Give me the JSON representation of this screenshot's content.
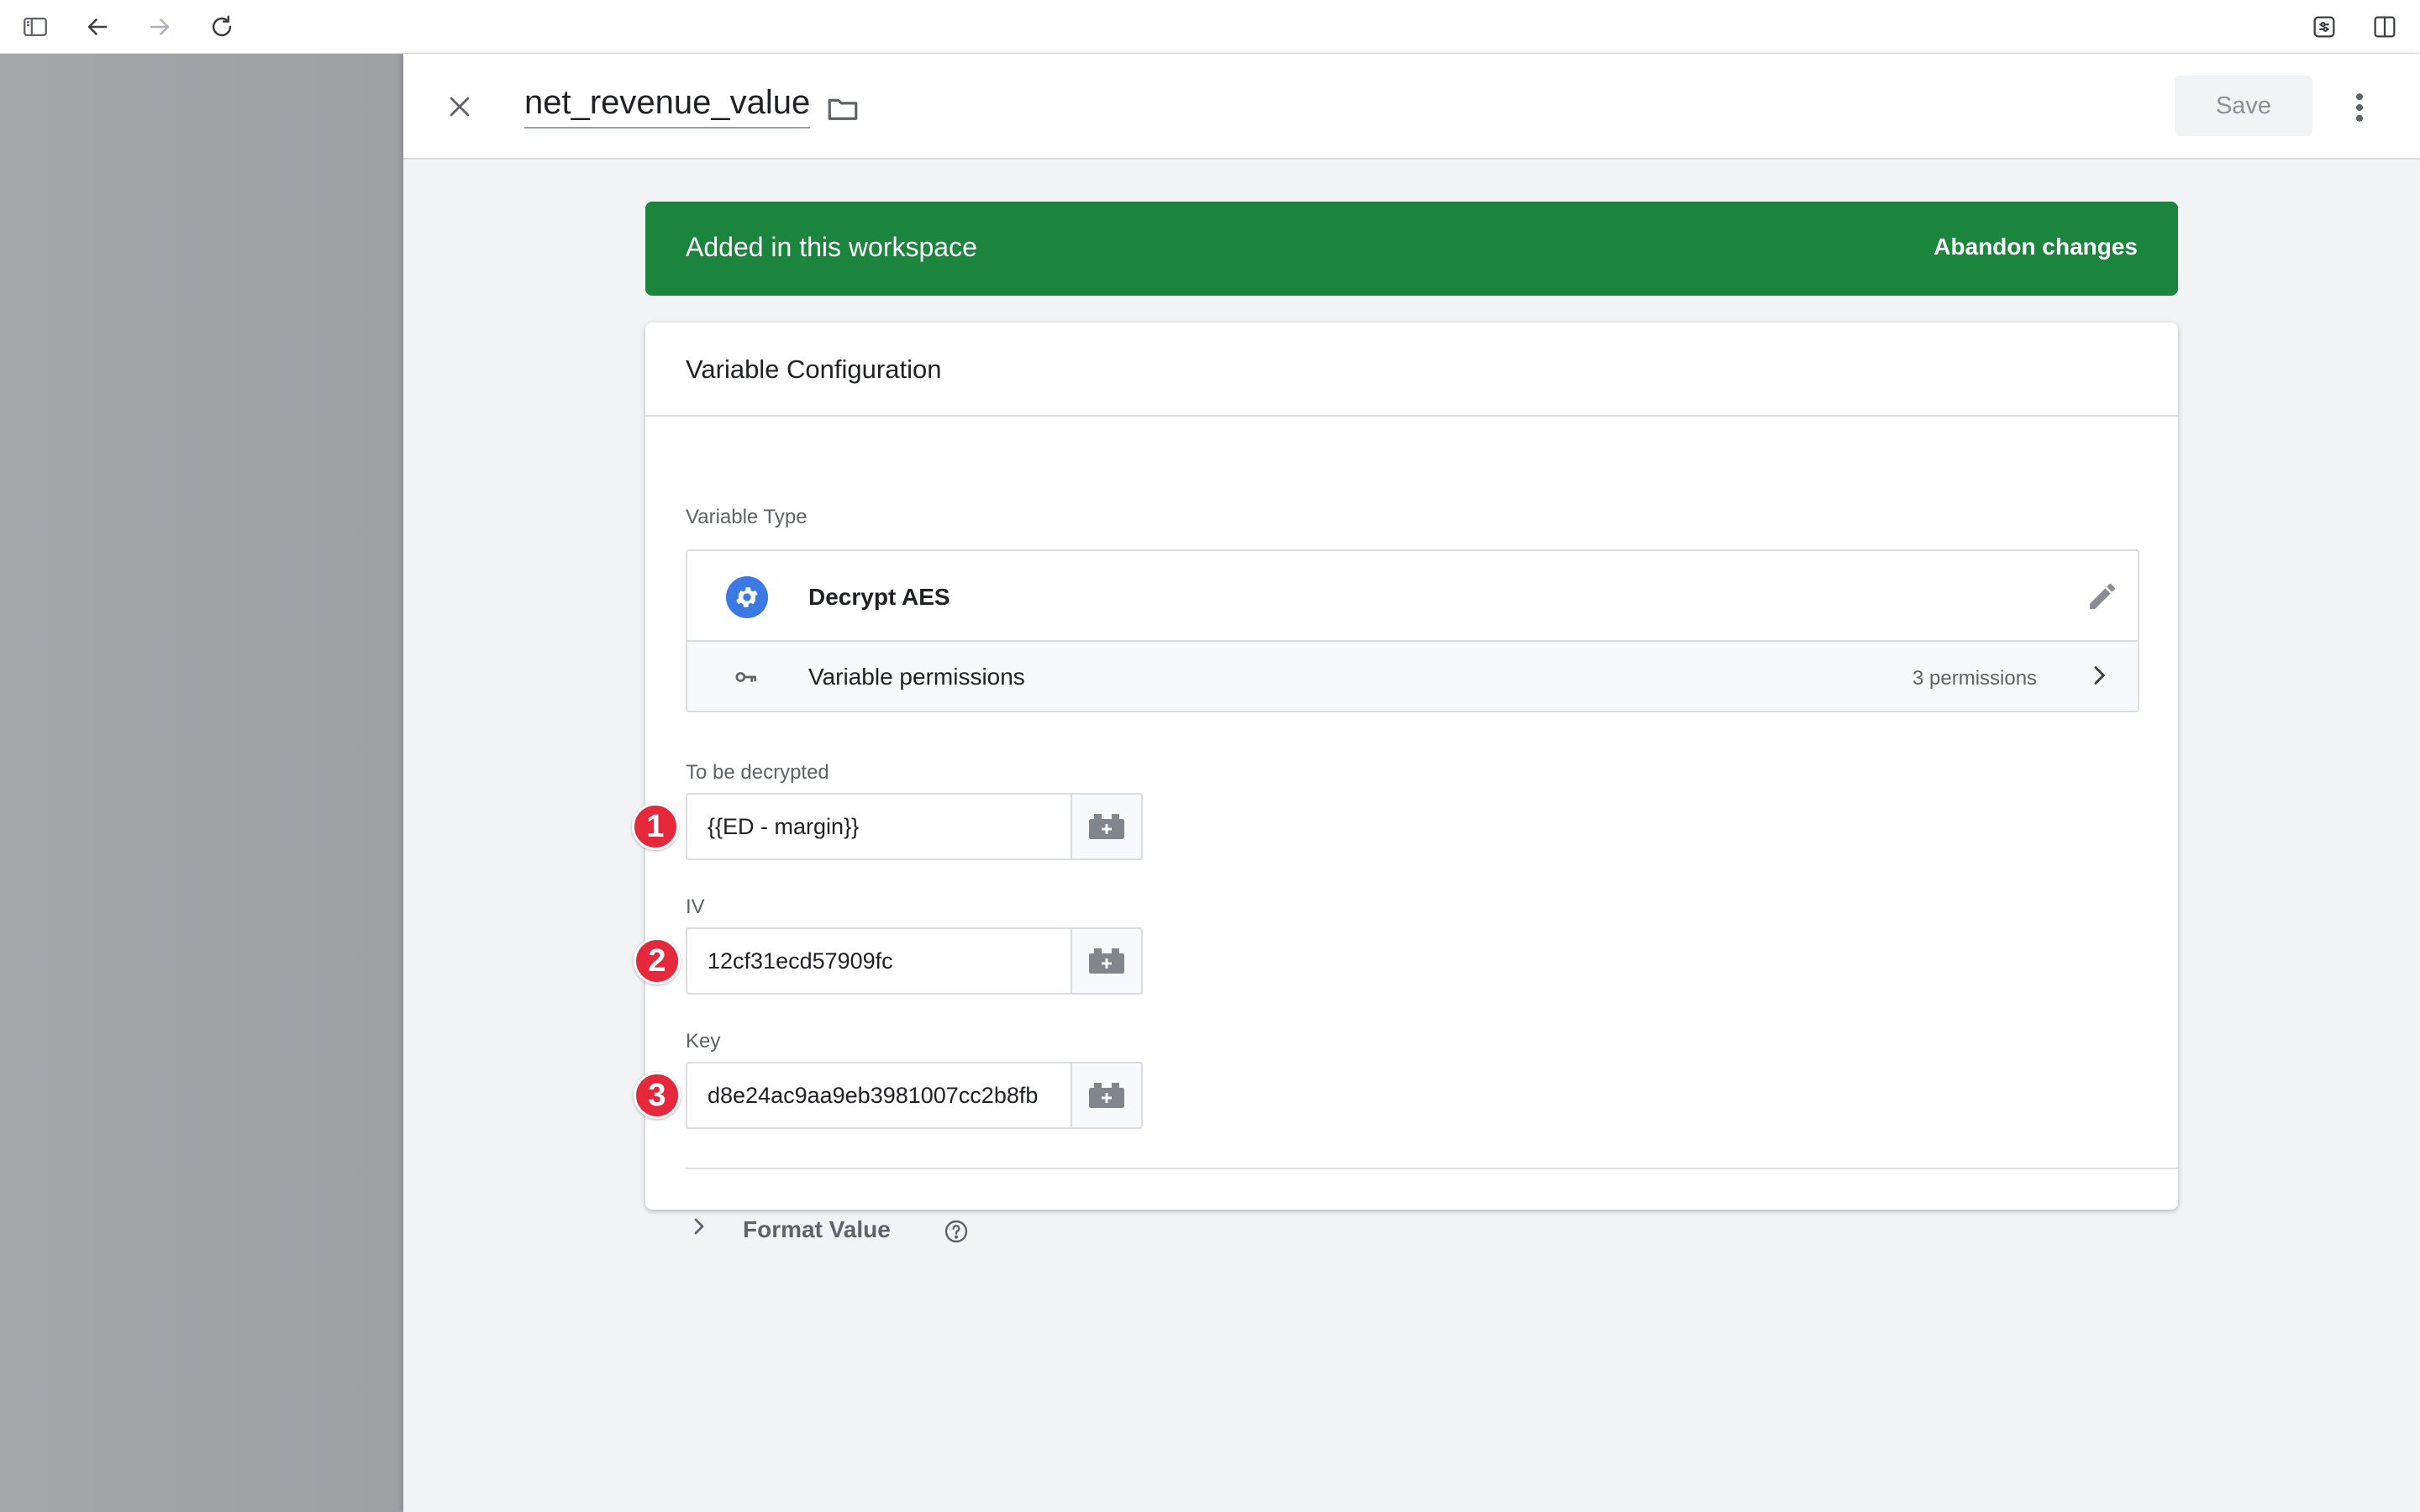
{
  "header": {
    "title": "net_revenue_value",
    "save_label": "Save"
  },
  "banner": {
    "text": "Added in this workspace",
    "link": "Abandon changes",
    "color": "#1b843d"
  },
  "card": {
    "title": "Variable Configuration",
    "variable_type_label": "Variable Type",
    "variable_type_name": "Decrypt AES",
    "permissions_label": "Variable permissions",
    "permissions_count": "3 permissions"
  },
  "fields": [
    {
      "label": "To be decrypted",
      "value": "{{ED - margin}}",
      "badge": "1"
    },
    {
      "label": "IV",
      "value": "12cf31ecd57909fc",
      "badge": "2"
    },
    {
      "label": "Key",
      "value": "d8e24ac9aa9eb3981007cc2b8fb",
      "badge": "3"
    }
  ],
  "format": {
    "label": "Format Value"
  },
  "colors": {
    "accent_blue": "#3b79e4",
    "badge_red": "#e5283b"
  },
  "icons": {
    "browser": [
      "sidebar-toggle-icon",
      "back-arrow-icon",
      "forward-arrow-icon",
      "reload-icon",
      "extension-icon",
      "split-view-icon"
    ],
    "header": [
      "close-icon",
      "folder-icon",
      "more-vert-icon"
    ],
    "type": [
      "gear-icon",
      "pencil-icon",
      "key-icon",
      "chevron-right-icon"
    ],
    "fields": "variable-brick-icon",
    "format": [
      "chevron-right-icon",
      "help-icon"
    ]
  }
}
